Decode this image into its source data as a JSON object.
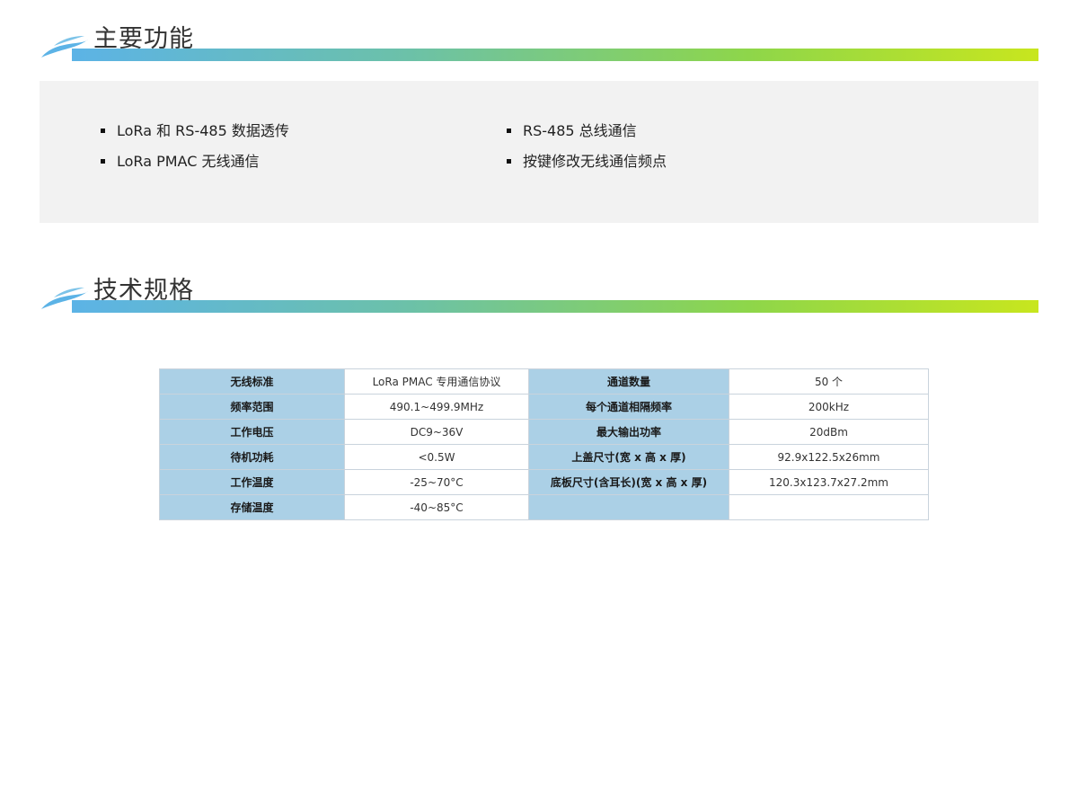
{
  "sections": {
    "features_title": "主要功能",
    "specs_title": "技术规格"
  },
  "features": {
    "left": [
      "LoRa 和 RS-485 数据透传",
      "LoRa PMAC 无线通信"
    ],
    "right": [
      "RS-485 总线通信",
      "按键修改无线通信频点"
    ]
  },
  "specs": [
    {
      "label1": "无线标准",
      "value1": "LoRa PMAC 专用通信协议",
      "label2": "通道数量",
      "value2": "50 个"
    },
    {
      "label1": "频率范围",
      "value1": "490.1~499.9MHz",
      "label2": "每个通道相隔频率",
      "value2": "200kHz"
    },
    {
      "label1": "工作电压",
      "value1": "DC9~36V",
      "label2": "最大输出功率",
      "value2": "20dBm"
    },
    {
      "label1": "待机功耗",
      "value1": "<0.5W",
      "label2": "上盖尺寸(宽 x 高 x 厚)",
      "value2": "92.9x122.5x26mm"
    },
    {
      "label1": "工作温度",
      "value1": "-25~70°C",
      "label2": "底板尺寸(含耳长)(宽 x 高 x 厚)",
      "value2": "120.3x123.7x27.2mm"
    },
    {
      "label1": "存储温度",
      "value1": "-40~85°C",
      "label2": "",
      "value2": ""
    }
  ],
  "colors": {
    "header_gradient_start": "#5cb3e6",
    "header_gradient_end": "#c8e61e",
    "label_cell_bg": "#abd0e6",
    "features_bg": "#f2f2f2"
  }
}
